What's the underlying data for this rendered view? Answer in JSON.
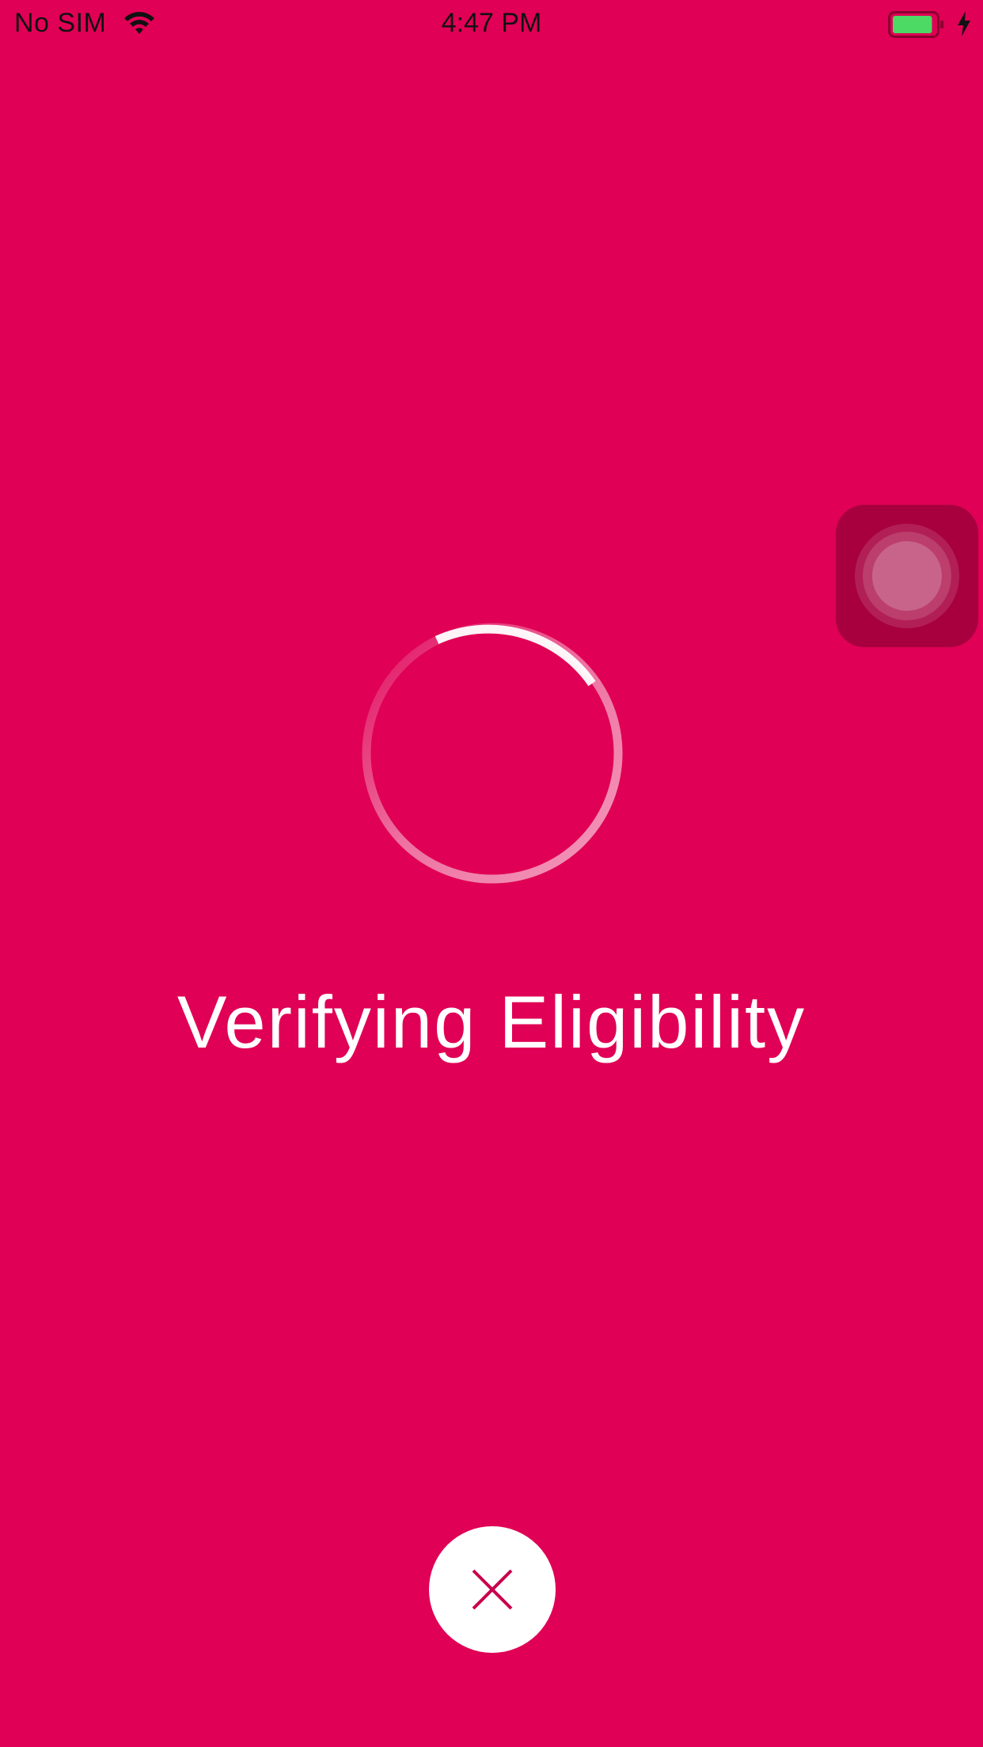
{
  "status_bar": {
    "carrier": "No SIM",
    "time": "4:47 PM",
    "wifi_icon": "wifi-icon",
    "battery_icon": "battery-icon",
    "battery_level": 0.9,
    "charging_icon": "charging-bolt-icon"
  },
  "loading": {
    "message": "Verifying Eligibility",
    "spinner_icon": "loading-spinner-icon"
  },
  "actions": {
    "close_icon": "close-icon"
  },
  "overlay": {
    "assistive_touch_icon": "assistive-touch-icon"
  },
  "colors": {
    "background": "#E00055",
    "text": "#FFFFFF",
    "close_button_bg": "#FFFFFF",
    "close_icon": "#C7004C",
    "battery_fill": "#4CD964"
  }
}
